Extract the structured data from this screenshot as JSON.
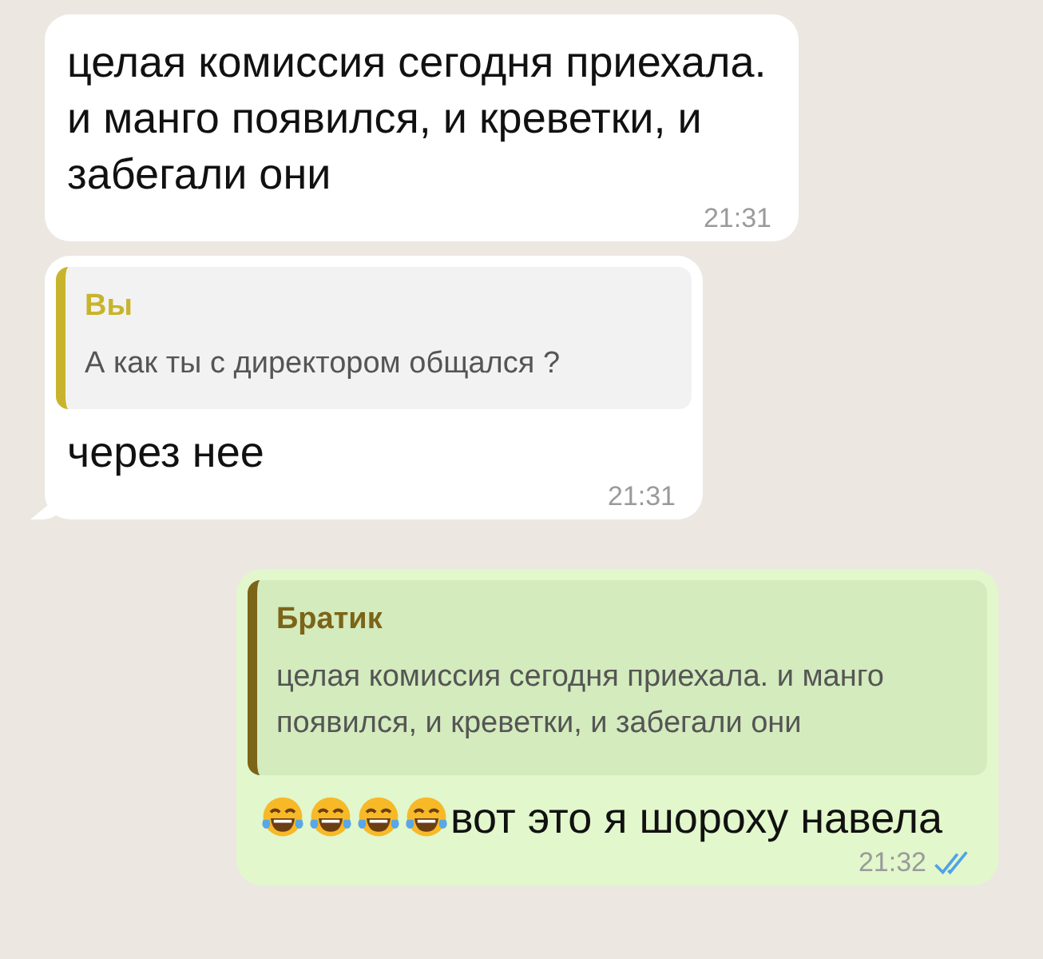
{
  "messages": [
    {
      "kind": "incoming",
      "text": "целая комиссия сегодня приехала. и манго появился, и креветки, и забегали они",
      "time": "21:31",
      "tail": false
    },
    {
      "kind": "incoming",
      "reply": {
        "author": "Вы",
        "color": "#c8b42c",
        "text": "А как ты с директором общался ?"
      },
      "text": "через нее",
      "time": "21:31",
      "tail": true
    },
    {
      "kind": "outgoing",
      "reply": {
        "author": "Братик",
        "color": "#7c6418",
        "text": "целая комиссия сегодня приехала. и манго появился, и креветки, и забегали они"
      },
      "emojis": [
        {
          "kind": "tears-of-joy"
        },
        {
          "kind": "tears-of-joy"
        },
        {
          "kind": "tears-of-joy"
        },
        {
          "kind": "tears-of-joy"
        }
      ],
      "text": "вот это я шороху навела",
      "time": "21:32",
      "read": true,
      "tail": false
    }
  ]
}
